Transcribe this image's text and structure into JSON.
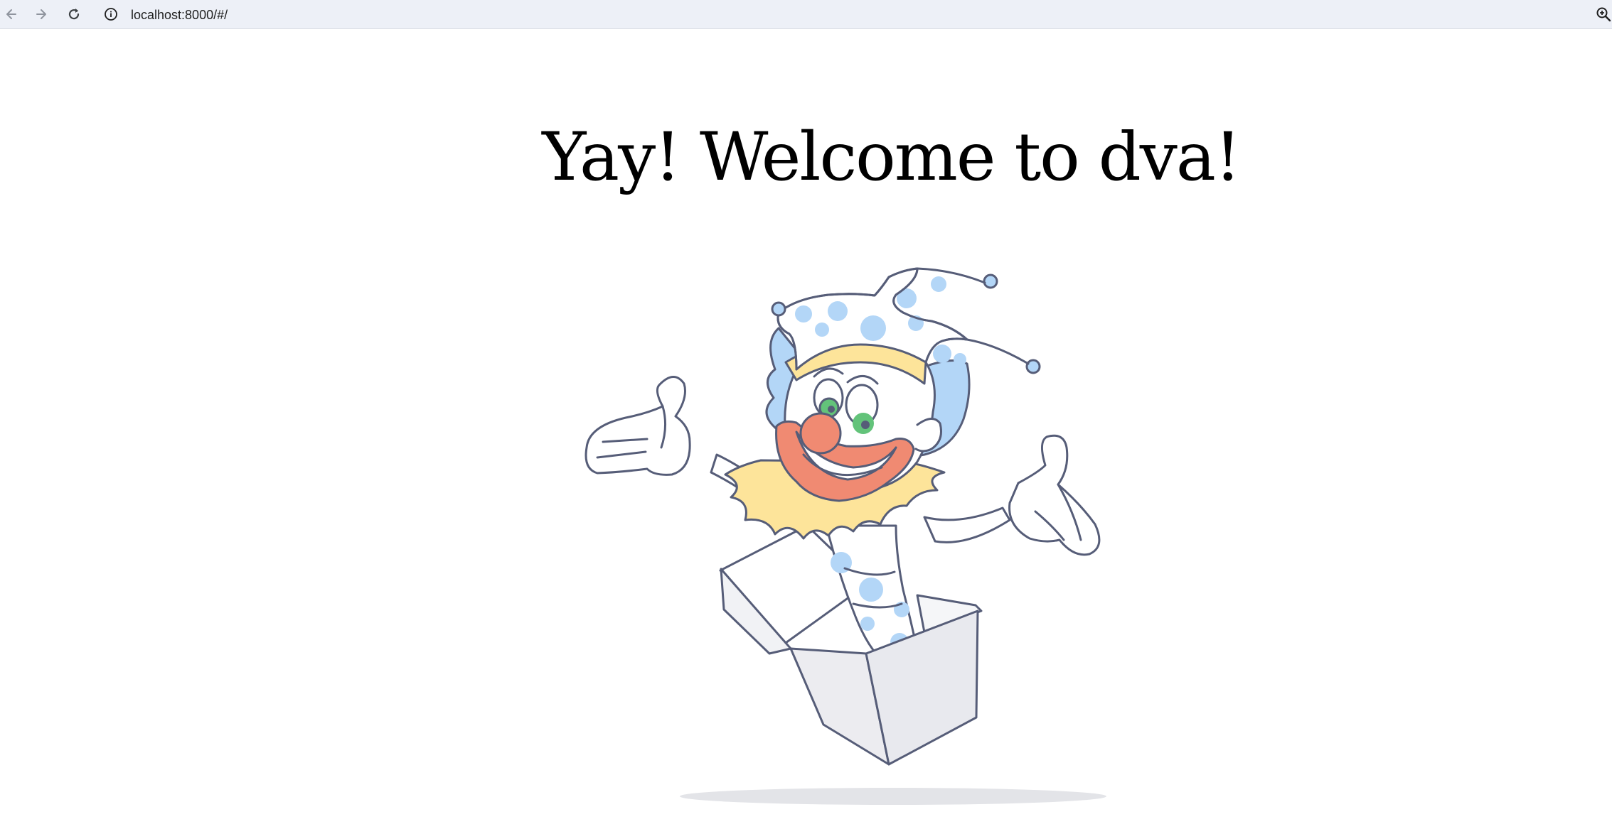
{
  "browser": {
    "url": "localhost:8000/#/",
    "back_icon": "arrow-left-icon",
    "forward_icon": "arrow-right-icon",
    "reload_icon": "reload-icon",
    "info_icon": "info-icon",
    "zoom_icon": "zoom-in-icon"
  },
  "page": {
    "title": "Yay! Welcome to dva!",
    "illustration": "jack-in-the-box-clown-illustration"
  },
  "colors": {
    "toolbar_bg": "#edf0f7",
    "outline": "#565d78",
    "polka_blue": "#b3d6f7",
    "collar_yellow": "#fde49a",
    "nose_mouth": "#f08a72",
    "eye_green": "#63c37a",
    "box_fill": "#ebecf0"
  }
}
